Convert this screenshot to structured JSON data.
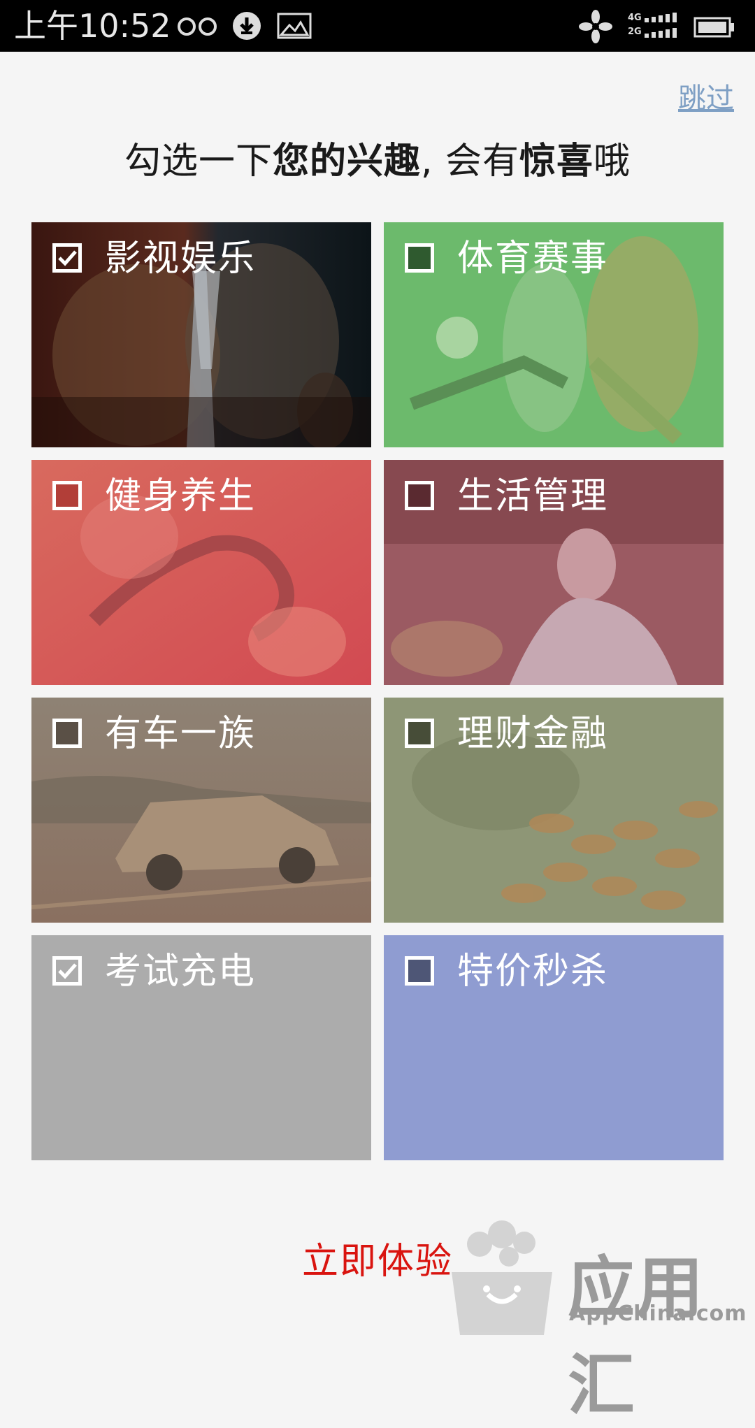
{
  "status_bar": {
    "time": "上午10:52",
    "left_icons": [
      "voicemail-icon",
      "download-icon",
      "image-icon"
    ],
    "right_icons": [
      "notification-flower-icon",
      "signal-4g-icon",
      "signal-2g-icon",
      "battery-icon"
    ],
    "net_top": "4G",
    "net_bottom": "2G"
  },
  "skip_label": "跳过",
  "headline": {
    "part1": "勾选一下",
    "part2": "您的兴趣",
    "part3": ", 会有",
    "part4": "惊喜",
    "part5": "哦"
  },
  "categories": [
    {
      "label": "影视娱乐",
      "checked": true,
      "overlay": "#1a1010"
    },
    {
      "label": "体育赛事",
      "checked": false,
      "overlay": "#6cba6c"
    },
    {
      "label": "健身养生",
      "checked": false,
      "overlay": "#d45f58"
    },
    {
      "label": "生活管理",
      "checked": false,
      "overlay": "#a35f6a"
    },
    {
      "label": "有车一族",
      "checked": false,
      "overlay": "#8a7a6a"
    },
    {
      "label": "理财金融",
      "checked": true,
      "overlay": "#8e9676"
    },
    {
      "label": "考试充电",
      "checked": true,
      "overlay": "#acacac"
    },
    {
      "label": "特价秒杀",
      "checked": false,
      "overlay": "#8f9cd1"
    }
  ],
  "cta_label": "立即体验",
  "watermark": {
    "brand": "应用汇",
    "sub": "AppChina.com"
  },
  "colors": {
    "accent_red": "#d9140f",
    "link_blue": "#7e9fc4"
  }
}
